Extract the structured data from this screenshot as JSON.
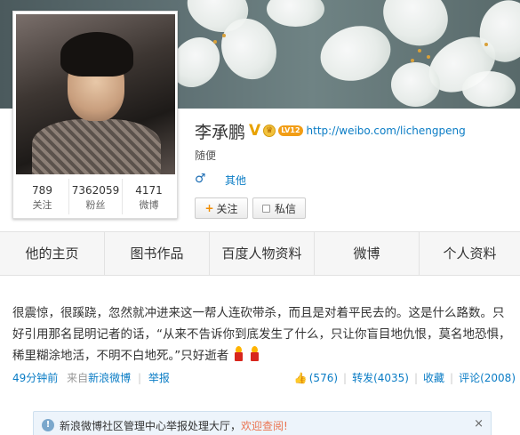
{
  "profile": {
    "name": "李承鹏",
    "verified_mark": "V",
    "level_badge": "LV12",
    "crown_icon": "crown-icon",
    "url": "http://weibo.com/lichengpeng",
    "intro": "随便",
    "gender_symbol": "♂",
    "category": "其他",
    "follow_button": "关注",
    "message_button": "私信",
    "stats": [
      {
        "num": "789",
        "label": "关注"
      },
      {
        "num": "7362059",
        "label": "粉丝"
      },
      {
        "num": "4171",
        "label": "微博"
      }
    ]
  },
  "tabs": [
    "他的主页",
    "图书作品",
    "百度人物资料",
    "微博",
    "个人资料"
  ],
  "post": {
    "text": "很震惊，很蹊跷，忽然就冲进来这一帮人连砍带杀，而且是对着平民去的。这是什么路数。只好引用那名昆明记者的话，“从来不告诉你到底发生了什么，只让你盲目地仇恨，莫名地恐惧，稀里糊涂地活，不明不白地死。”只好逝者",
    "time": "49分钟前",
    "source_prefix": "来自",
    "source": "新浪微博",
    "report": "举报",
    "likes": "(576)",
    "repost": "转发(4035)",
    "favorite": "收藏",
    "comment": "评论(2008)"
  },
  "notice": {
    "text": "新浪微博社区管理中心举报处理大厅，",
    "link": "欢迎查阅!",
    "close": "×"
  }
}
